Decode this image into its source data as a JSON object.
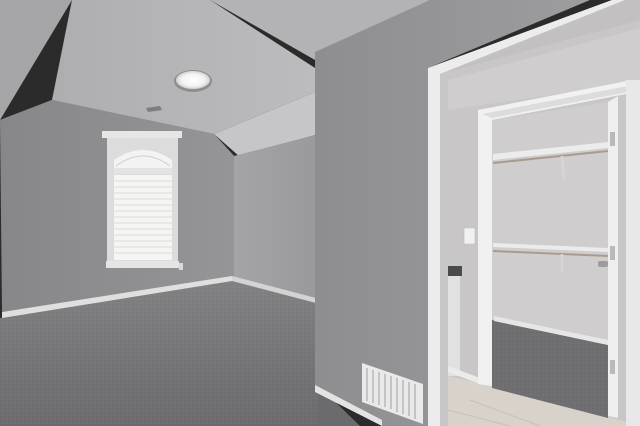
{
  "scene": {
    "subject": "vacant-bedroom-interior",
    "colors": {
      "wall_light": "#9c9c9e",
      "wall_mid": "#8f8f91",
      "wall_shadow": "#7f7f82",
      "ceiling": "#a9a9ab",
      "ceiling_light": "#c7c7c9",
      "carpet": "#807f80",
      "carpet_dark": "#6f6e70",
      "trim": "#e9e9ea",
      "closet_wall": "#c9c7c7",
      "tile": "#d6d0c8",
      "window_glass": "#f4f4f2"
    },
    "icons": [
      "ceiling-light-icon",
      "window-icon",
      "air-vent-icon",
      "closet-rod-icon",
      "light-switch-icon",
      "door-hinge-icon"
    ]
  }
}
